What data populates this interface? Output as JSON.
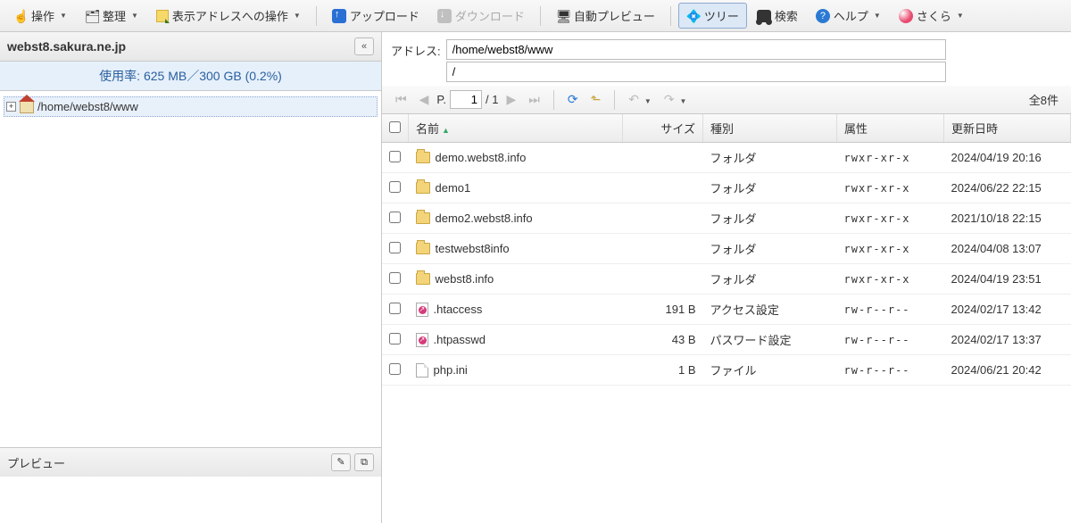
{
  "toolbar": {
    "operate": "操作",
    "organize": "整理",
    "addr_action": "表示アドレスへの操作",
    "upload": "アップロード",
    "download": "ダウンロード",
    "auto_preview": "自動プレビュー",
    "tree": "ツリー",
    "search": "検索",
    "help": "ヘルプ",
    "sakura": "さくら"
  },
  "left": {
    "domain": "webst8.sakura.ne.jp",
    "usage": "使用率: 625 MB／300 GB (0.2%)",
    "tree_path": "/home/webst8/www",
    "preview_label": "プレビュー"
  },
  "address": {
    "label": "アドレス:",
    "value1": "/home/webst8/www",
    "value2": "/"
  },
  "pager": {
    "label": "P.",
    "current": "1",
    "total": "/ 1",
    "count": "全8件"
  },
  "columns": {
    "name": "名前",
    "size": "サイズ",
    "kind": "種別",
    "attr": "属性",
    "updated": "更新日時"
  },
  "files": [
    {
      "name": "demo.webst8.info",
      "size": "",
      "kind": "フォルダ",
      "attr": "rwxr-xr-x",
      "updated": "2024/04/19 20:16",
      "icon": "folder"
    },
    {
      "name": "demo1",
      "size": "",
      "kind": "フォルダ",
      "attr": "rwxr-xr-x",
      "updated": "2024/06/22 22:15",
      "icon": "folder"
    },
    {
      "name": "demo2.webst8.info",
      "size": "",
      "kind": "フォルダ",
      "attr": "rwxr-xr-x",
      "updated": "2021/10/18 22:15",
      "icon": "folder"
    },
    {
      "name": "testwebst8info",
      "size": "",
      "kind": "フォルダ",
      "attr": "rwxr-xr-x",
      "updated": "2024/04/08 13:07",
      "icon": "folder"
    },
    {
      "name": "webst8.info",
      "size": "",
      "kind": "フォルダ",
      "attr": "rwxr-xr-x",
      "updated": "2024/04/19 23:51",
      "icon": "folder"
    },
    {
      "name": ".htaccess",
      "size": "191 B",
      "kind": "アクセス設定",
      "attr": "rw-r--r--",
      "updated": "2024/02/17 13:42",
      "icon": "htfile"
    },
    {
      "name": ".htpasswd",
      "size": "43 B",
      "kind": "パスワード設定",
      "attr": "rw-r--r--",
      "updated": "2024/02/17 13:37",
      "icon": "htfile"
    },
    {
      "name": "php.ini",
      "size": "1 B",
      "kind": "ファイル",
      "attr": "rw-r--r--",
      "updated": "2024/06/21 20:42",
      "icon": "file"
    }
  ]
}
